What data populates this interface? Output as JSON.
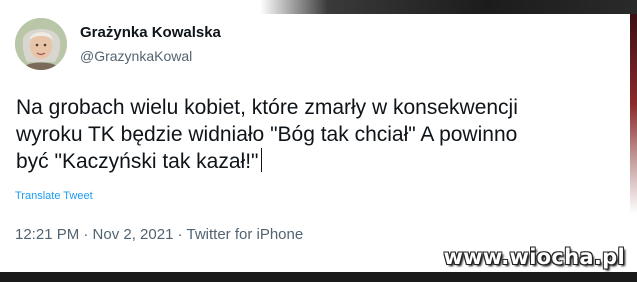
{
  "tweet": {
    "author_name": "Grażynka Kowalska",
    "author_handle": "@GrazynkaKowal",
    "text": "Na grobach wielu kobiet, które zmarły  w konsekwencji\nwyroku TK będzie widniało \"Bóg tak chciał\" A powinno\nbyć \"Kaczyński tak kazał!\"",
    "translate_label": "Translate Tweet",
    "meta": "12:21 PM · Nov 2, 2021 · Twitter for iPhone"
  },
  "avatar": {
    "icon": "profile-photo"
  },
  "watermark": {
    "text": "www.wiocha.pl"
  },
  "colors": {
    "text": "#0f1419",
    "secondary": "#536471",
    "link": "#1d9bf0",
    "background": "#ffffff"
  }
}
